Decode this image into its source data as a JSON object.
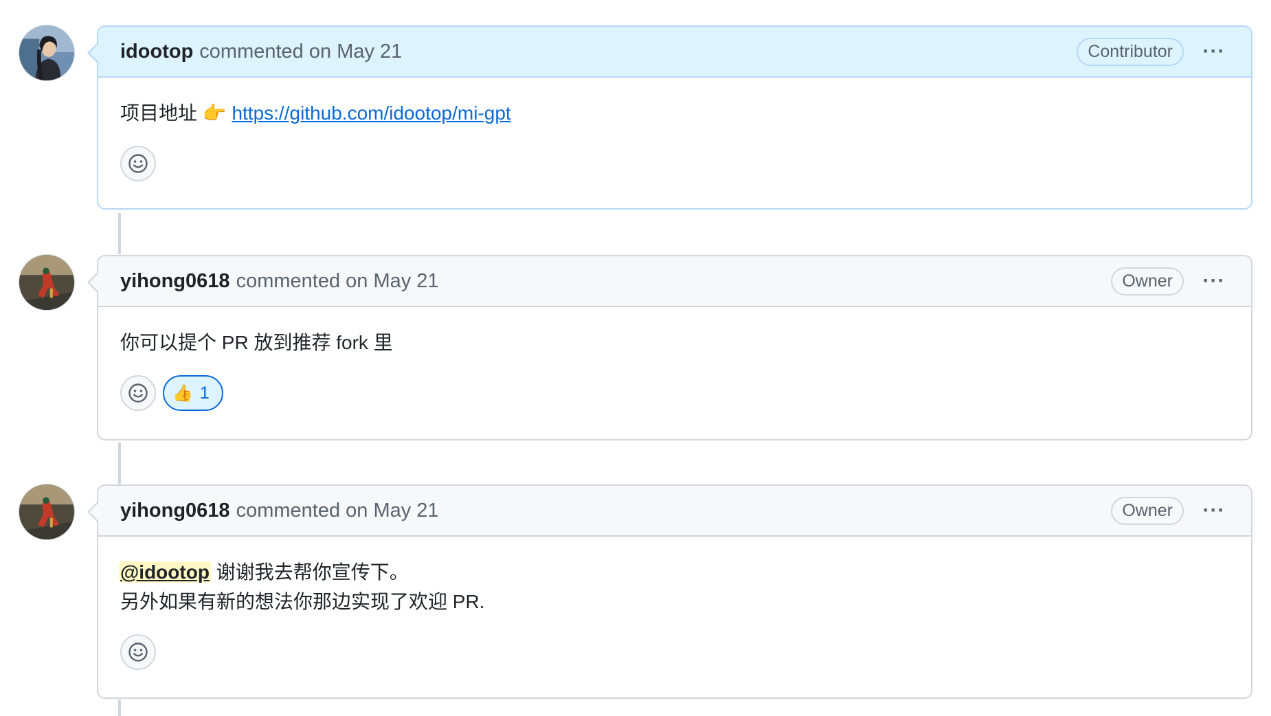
{
  "comments": [
    {
      "author": "idootop",
      "action": "commented",
      "date": "on May 21",
      "role": "Contributor",
      "body_prefix": "项目地址",
      "pointer_emoji": "👉",
      "link_text": "https://github.com/idootop/mi-gpt",
      "avatar_icon": "user-photo-icon"
    },
    {
      "author": "yihong0618",
      "action": "commented",
      "date": "on May 21",
      "role": "Owner",
      "body": "你可以提个 PR 放到推荐 fork 里",
      "reactions": [
        {
          "emoji": "👍",
          "count": "1"
        }
      ],
      "avatar_icon": "user-photo-icon"
    },
    {
      "author": "yihong0618",
      "action": "commented",
      "date": "on May 21",
      "role": "Owner",
      "mention": "@idootop",
      "body_line1": "谢谢我去帮你宣传下。",
      "body_line2": "另外如果有新的想法你那边实现了欢迎 PR.",
      "avatar_icon": "user-photo-icon"
    }
  ],
  "more_label": "···",
  "colors": {
    "link": "#0969da",
    "author_header": "#ddf4ff",
    "header": "#f6f8fa",
    "border": "#d0d7de",
    "mention_bg": "#fff8c5"
  }
}
